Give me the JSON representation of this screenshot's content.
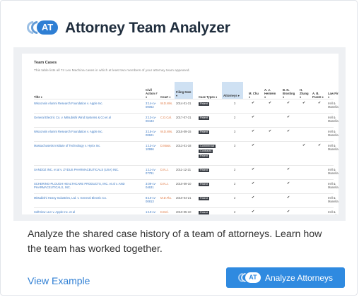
{
  "header": {
    "logo_text": "AT",
    "title": "Attorney Team Analyzer"
  },
  "preview": {
    "section_title": "Team Cases",
    "description": "This table lists all 74 Lex Machina cases in which at least two members of your attorney team appeared.",
    "columns": {
      "title": "Title ♦",
      "docket": "Civil Action # ♦",
      "court": "Court ♦",
      "filing_date": "Filing Date ▾",
      "case_types": "Case Types ♦",
      "attorneys": "Attorneys ▾",
      "att_1": "M. Chu ♦",
      "att_2": "A. J. Heinlein ♦",
      "att_3": "B. N. Brosting ♦",
      "att_4": "H. Zhang ♦",
      "att_5": "A. B. Fraste ♦",
      "law_firm": "Law Firm ♦"
    },
    "rows": [
      {
        "title": "Wisconsin Alumni Research Foundation v. Apple Inc.",
        "docket": "3:14-cv-00062",
        "court": "W.D.Wis.",
        "date": "2014-01-31",
        "types": [
          "Patent"
        ],
        "attorneys": "3",
        "checks": [
          1,
          1,
          1,
          1,
          1
        ],
        "firm": "Irell & Manella"
      },
      {
        "title": "General Electric Co. v. Mitsubishi Wind Systems & Co et al",
        "docket": "2:13-cv-00443",
        "court": "C.D.Cal.",
        "date": "2017-07-31",
        "types": [
          "Patent"
        ],
        "attorneys": "2",
        "checks": [
          1,
          0,
          1,
          0,
          0
        ],
        "firm": "Irell & Manella"
      },
      {
        "title": "Wisconsin Alumni Research Foundation v. Apple Inc.",
        "docket": "3:15-cv-00621",
        "court": "W.D.Wis.",
        "date": "2015-09-15",
        "types": [
          "Patent"
        ],
        "attorneys": "3",
        "checks": [
          1,
          1,
          1,
          0,
          0
        ],
        "firm": "Irell & Manella"
      },
      {
        "title": "Massachusetts Institute of Technology v. Hynix Inc.",
        "docket": "1:13-cv-10996",
        "court": "D.Mass.",
        "date": "2013-01-18",
        "types": [
          "Commercial",
          "Contracts",
          "Patent"
        ],
        "attorneys": "3",
        "checks": [
          1,
          0,
          0,
          1,
          1
        ],
        "firm": "Irell & Manella"
      },
      {
        "title": "SANDOZ INC. et al v. ZYDUS PHARMACEUTICALS (USA) INC.",
        "docket": "1:11-cv-07791",
        "court": "D.N.J.",
        "date": "2011-12-21",
        "types": [
          "Patent"
        ],
        "attorneys": "2",
        "checks": [
          1,
          0,
          1,
          0,
          0
        ],
        "firm": "Irell & Manella"
      },
      {
        "title": "SCHERING-PLOUGH HEALTHCARE PRODUCTS, INC. et al v. AND PHARMACEUTICALS, INC.",
        "docket": "3:09-cv-04631",
        "court": "D.N.J.",
        "date": "2010-09-10",
        "types": [
          "Patent"
        ],
        "attorneys": "2",
        "checks": [
          1,
          0,
          1,
          0,
          0
        ],
        "firm": "Irell & Manella"
      },
      {
        "title": "Mitsubishi Heavy Industries, Ltd. v. General Electric Co.",
        "docket": "8:10-cv-00813",
        "court": "M.D.Fla.",
        "date": "2010-04-21",
        "types": [
          "Patent"
        ],
        "attorneys": "2",
        "checks": [
          1,
          0,
          1,
          0,
          0
        ],
        "firm": "Irell & Manella"
      },
      {
        "title": "SoftView LLC v. Apple Inc. et al",
        "docket": "1:10-cv-00389",
        "court": "D.Del.",
        "date": "2010-05-10",
        "types": [
          "Patent"
        ],
        "attorneys": "2",
        "checks": [
          1,
          0,
          1,
          0,
          0
        ],
        "firm": "Irell & Manella"
      },
      {
        "title": "Wisconsin Alumni Research Foundation v. Intel Corporation",
        "docket": "3:08-cv-00078",
        "court": "W.D.Wis.",
        "date": "2008-02-05",
        "types": [
          "Commercial",
          "Patent"
        ],
        "attorneys": "3",
        "checks": [
          1,
          1,
          1,
          0,
          0
        ],
        "firm": "Irell & Manella"
      }
    ]
  },
  "description": "Analyze the shared case history of a team of attorneys. Learn how the team has worked together.",
  "footer": {
    "view_example": "View Example",
    "analyze_label": "Analyze Attorneys",
    "button_logo_text": "AT"
  },
  "icons": {
    "logo": "attorney-team-logo-icon",
    "check": "check-icon"
  },
  "colors": {
    "accent": "#2f7fd4",
    "button": "#2f8ae0",
    "court": "#e07a45",
    "tag": "#3b3f46"
  }
}
